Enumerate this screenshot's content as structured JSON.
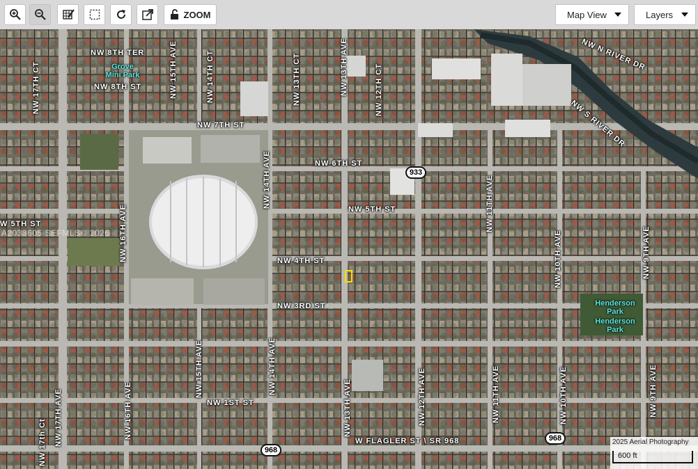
{
  "toolbar": {
    "zoom_in_icon": "zoom-in-icon",
    "zoom_out_icon": "zoom-out-icon",
    "edit_icon": "edit-grid-icon",
    "select_icon": "select-box-icon",
    "refresh_icon": "refresh-icon",
    "external_icon": "external-link-icon",
    "lock_icon": "unlock-icon",
    "zoom_label": "ZOOM",
    "map_view_label": "Map View",
    "layers_label": "Layers"
  },
  "map": {
    "streets": {
      "nw_8th_ter": "NW 8TH TER",
      "nw_8th_st": "NW 8TH ST",
      "nw_7th_st": "NW 7TH ST",
      "nw_6th_st": "NW 6TH ST",
      "nw_5th_st_right": "NW 5TH ST",
      "nw_5th_st_left": "W 5TH ST",
      "nw_4th_st": "NW 4TH ST",
      "nw_3rd_st": "NW 3RD ST",
      "nw_1st_st": "NW 1ST ST",
      "w_flagler": "W FLAGLER ST \\ SR 968",
      "nw_n_river_dr": "NW N RIVER DR",
      "nw_s_river_dr": "NW S RIVER DR",
      "nw_17th_ct_top": "NW 17TH CT",
      "nw_16th_ave_top": "NW 16TH AVE",
      "nw_15th_ave_top": "NW 15TH AVE",
      "nw_14th_ct": "NW 14TH CT",
      "nw_13th_ct": "NW 13TH CT",
      "nw_13th_ave_top": "NW 13TH AVE",
      "nw_12th_ct": "NW 12TH CT",
      "nw_14th_ave_top": "NW 14TH AVE",
      "nw_11th_ave_top": "NW 11TH AVE",
      "nw_10th_ave_top": "NW 10TH AVE",
      "nw_9th_ave_top": "NW 9TH AVE",
      "nw_17th_ave": "NW 17TH AVE",
      "nw_17th_ct_bottom": "NW 17th Ct",
      "nw_16th_ave_bottom": "NW 16TH AVE",
      "nw_15th_ave_bottom": "NW 15TH AVE",
      "nw_14th_ave_bottom": "NW 14TH AVE",
      "nw_13th_ave_bottom": "NW 13TH AVE",
      "nw_12th_ave": "NW 12TH AVE",
      "nw_11th_ave_bottom": "NW 11TH AVE",
      "nw_10th_ave_bottom": "NW 10TH AVE",
      "nw_9th_ave_bottom": "NW 9TH AVE"
    },
    "parks": {
      "grove_mini_line1": "Grove",
      "grove_mini_line2": "Mini Park",
      "henderson_a_line1": "Henderson",
      "henderson_a_line2": "Park",
      "henderson_b_line1": "Henderson",
      "henderson_b_line2": "Park"
    },
    "route_shields": {
      "r933": "933",
      "r968_left": "968",
      "r968_right": "968"
    },
    "watermark": "A2033605 SEFMLS© 2026",
    "attribution": "2025 Aerial Photography",
    "scale_label": "600 ft"
  },
  "colors": {
    "marker": "#f7e000",
    "park_label": "#5ce6e0"
  }
}
